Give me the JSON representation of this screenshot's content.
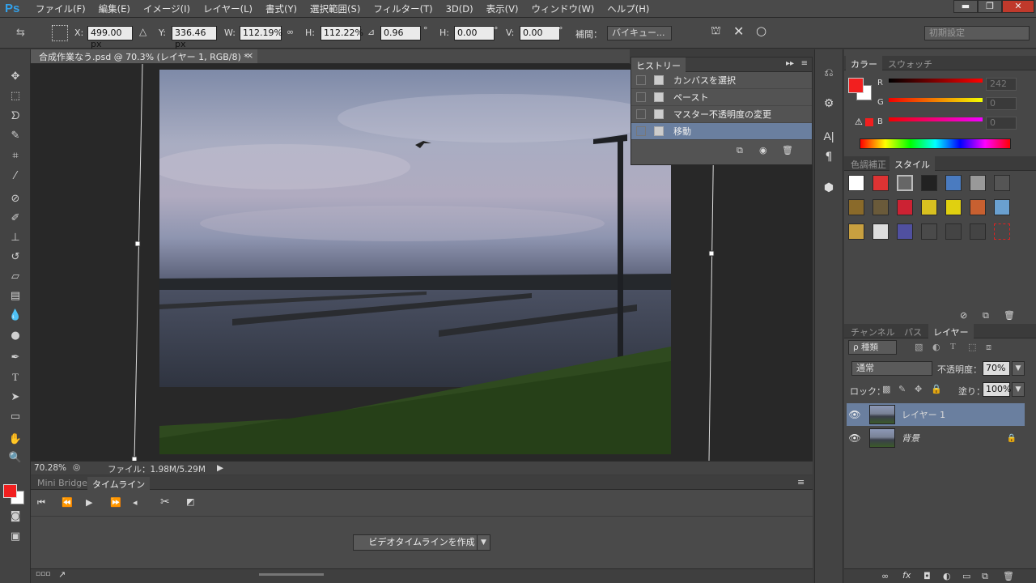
{
  "app": {
    "logo": "Ps"
  },
  "menu": [
    "ファイル(F)",
    "編集(E)",
    "イメージ(I)",
    "レイヤー(L)",
    "書式(Y)",
    "選択範囲(S)",
    "フィルター(T)",
    "3D(D)",
    "表示(V)",
    "ウィンドウ(W)",
    "ヘルプ(H)"
  ],
  "window_buttons": {
    "minimize": "▬",
    "restore": "❐",
    "close": "✕"
  },
  "options": {
    "x_label": "X:",
    "x_value": "499.00 px",
    "y_label": "Y:",
    "y_value": "336.46 px",
    "w_label": "W:",
    "w_value": "112.19%",
    "h_label": "H:",
    "h_value": "112.22%",
    "angle_value": "0.96",
    "angle_unit": "°",
    "hskew_label": "H:",
    "hskew_value": "0.00",
    "hskew_unit": "°",
    "vskew_label": "V:",
    "vskew_value": "0.00",
    "vskew_unit": "°",
    "interp_label": "補間：",
    "interp_value": "バイキュー...",
    "workspace": "初期設定"
  },
  "document": {
    "tab_title": "合成作業なう.psd @ 70.3% (レイヤー 1, RGB/8) *",
    "tab_close": "×"
  },
  "status": {
    "zoom": "70.28%",
    "file_info": "ファイル：1.98M/5.29M"
  },
  "timeline": {
    "tabs": [
      "Mini Bridge",
      "タイムライン"
    ],
    "create_button": "ビデオタイムラインを作成"
  },
  "history": {
    "title": "ヒストリー",
    "items": [
      "カンバスを選択",
      "ペースト",
      "マスター不透明度の変更",
      "移動"
    ],
    "selected": 3
  },
  "color": {
    "tabs": [
      "カラー",
      "スウォッチ"
    ],
    "r_label": "R",
    "g_label": "G",
    "b_label": "B",
    "r_value": "242",
    "g_value": "0",
    "b_value": "0",
    "foreground": "#f21f1f",
    "background": "#ffffff"
  },
  "styles": {
    "tabs": [
      "色調補正",
      "スタイル"
    ]
  },
  "layers": {
    "tabs": [
      "チャンネル",
      "パス",
      "レイヤー"
    ],
    "kind_filter": "ρ 種類",
    "blend_mode": "通常",
    "opacity_label": "不透明度：",
    "opacity_value": "70%",
    "lock_label": "ロック：",
    "fill_label": "塗り：",
    "fill_value": "100%",
    "items": [
      {
        "name": "レイヤー 1",
        "selected": true
      },
      {
        "name": "背景",
        "locked": true
      }
    ]
  }
}
